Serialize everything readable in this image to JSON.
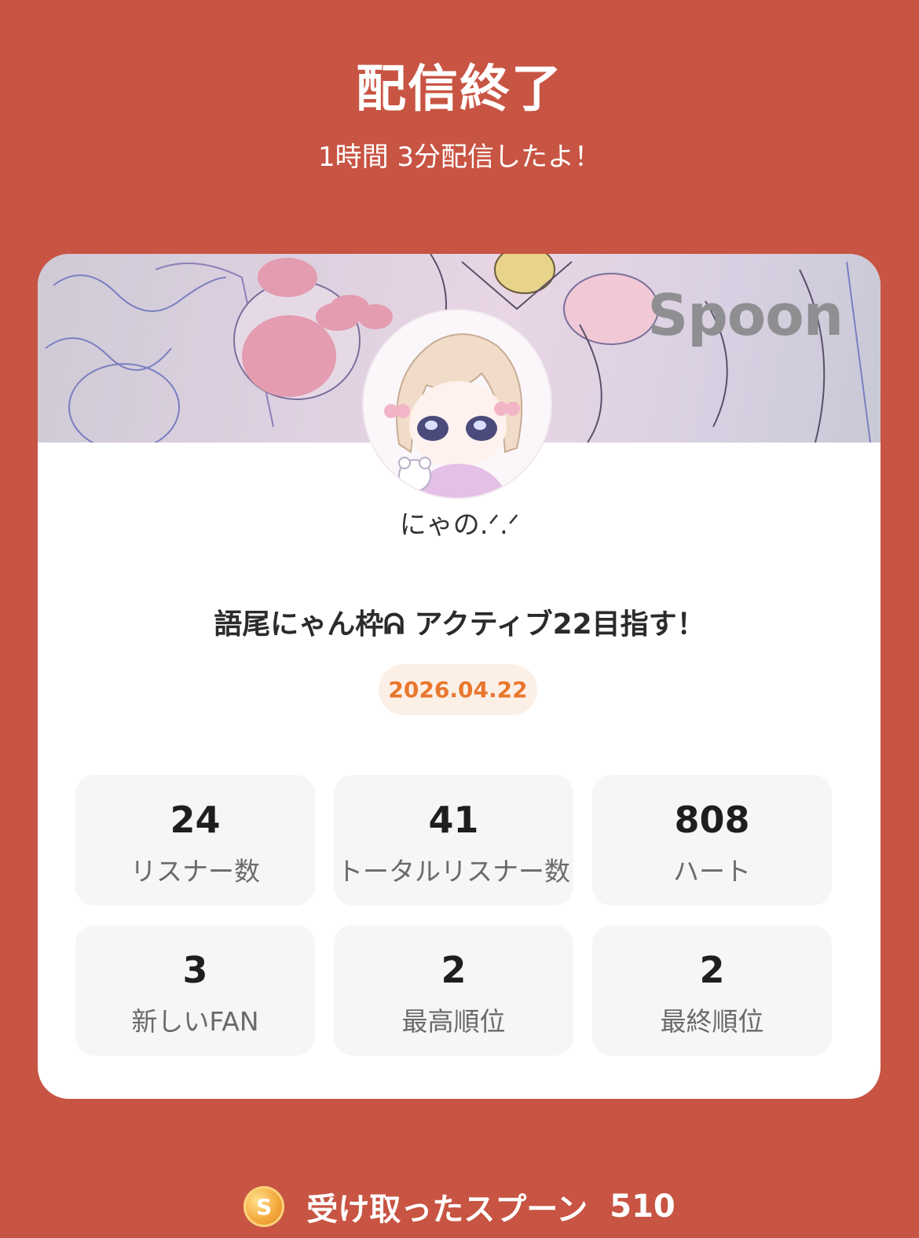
{
  "header": {
    "title": "配信終了",
    "subtitle": "1時間 3分配信したよ！"
  },
  "card": {
    "banner_logo": "Spoon",
    "username": "にゃの.ᐟ.ᐟ",
    "live_title": "語尾にゃん枠ᕱ アクティブ22目指す！",
    "date": "2026.04.22",
    "stats": [
      {
        "value": "24",
        "label": "リスナー数"
      },
      {
        "value": "41",
        "label": "トータルリスナー数"
      },
      {
        "value": "808",
        "label": "ハート"
      },
      {
        "value": "3",
        "label": "新しいFAN"
      },
      {
        "value": "2",
        "label": "最高順位"
      },
      {
        "value": "2",
        "label": "最終順位"
      }
    ]
  },
  "footer": {
    "coin_letter": "S",
    "label": "受け取ったスプーン",
    "value": "510"
  },
  "colors": {
    "background": "#c85443",
    "date_text": "#e8772e",
    "date_bg": "#fcefe6"
  }
}
